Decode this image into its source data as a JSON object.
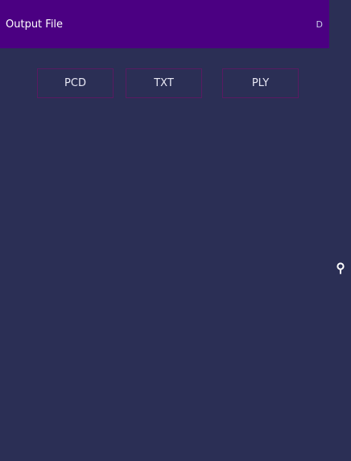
{
  "header": {
    "title": "Output File",
    "action_label": "D"
  },
  "formats": {
    "pcd_label": "PCD",
    "txt_label": "TXT",
    "ply_label": "PLY"
  },
  "icons": {
    "side": "pin-icon"
  },
  "colors": {
    "background": "#2b2f55",
    "header": "#4b0082",
    "button_border": "#5a1a62",
    "text": "#e8e8f4"
  }
}
